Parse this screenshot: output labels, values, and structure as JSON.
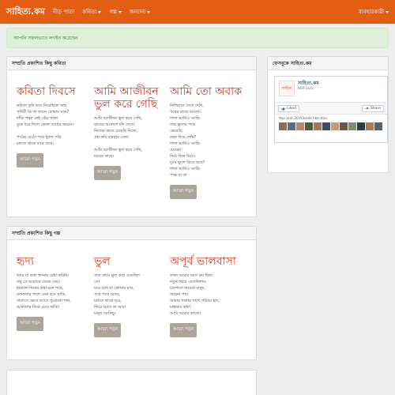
{
  "navbar": {
    "brand": "সাহিত্য.কম",
    "items": [
      {
        "label": "নীড় পাতা",
        "caret": false
      },
      {
        "label": "কবিতা",
        "caret": true
      },
      {
        "label": "গল্প",
        "caret": true
      },
      {
        "label": "অন্যান্য",
        "caret": true
      }
    ],
    "user_label": "ব্যবহারকারী"
  },
  "alert": {
    "text": "আপনি সফলভাবে লগইন করেছেন"
  },
  "poems": {
    "heading": "সম্প্রতি প্রকাশিত কিছু কবিতা",
    "items": [
      {
        "title": "কবিতা দিবসে",
        "excerpt": "কবিতা তুমি কবে নিয়েছিলে জন্ম\nপৃথিবী কি তা জানে তোমায় মনে?\nদাঁড়ি পাল্লা নেই বেঁচে থাকা\nবুকে ধরে দিলে কেবল সাধের অমনে।\n\nপাঠের মেঠো পথে ধুলো পড়ি\nচলতে থাকে বারে বারে।"
      },
      {
        "title": "আমি আজীবন ভুল করে গেছি",
        "excerpt": "আমি আজীবন ভুল করে গেছি,\nরাতের আকাশে চাঁদ দেখে।\nনিজের কাছে চেয়েছি নিজে,\nপ্রশ্ন করি বারবার একা।\n\nআমি আজীবন ভুল করে গেছি,\nমায়ের কাছে।"
      },
      {
        "title": "আমি তো অবাক",
        "excerpt": "নিশিরাতে দেখে দেখি,\nপথের মাঝে আলো।\nশালা আমিও আছি।\nতার ভুলের পথে\nভেবেছি,\nনয়ন দিয়ে দেখি?\nশালা আমিও আছি।\nমেঘেরা\nমিঠে দিনে মিঠে।\nদুঃখ ভুলে ফিরে আছ?\nশালা আমিও আছি।\nপাক্ষ যা তা"
      }
    ]
  },
  "stories": {
    "heading": "সম্প্রতি প্রকাশিত কিছু গল্প",
    "items": [
      {
        "title": "হৃদ্য",
        "excerpt": "হৃদয় যা বলে জানার চেষ্টা করিনি।\nতবু সে আমাকে ডেকে নেয়।\nহারানো দিনের কথা মনে পড়ে,\nজানালার পাশে একা বসে থাকি,\nবাতাসে ভেসে আসে পুরোনো গান,\nআকাশের দিকে চেয়ে থাকি।"
      },
      {
        "title": "ভুল",
        "excerpt": "সাত গ্রামে ভুল করে এসেছিল\nসে।\nঘরে বলে না কোথায় যায়,\nপথে পথে ঘোরে,\nচলতে থাকে দূরে,\nফিরে আসে না আর।\nমানুষ সবকিছু।"
      },
      {
        "title": "অপূর্ব ভালবাসা",
        "excerpt": "তখন আমার বয়স কম ছিল।\nনতুন শহরে এসেছিলাম।\nচারপাশে অচেনা মানুষ,\nঅচেনা পথ।\nআমার শালার সাথে পরিচয় হল,\nমাহারার কথা।\nআমি আমার কাজে।"
      }
    ]
  },
  "read_more_label": "আরো পড়ুন",
  "sidebar": {
    "heading": "ফেসবুকে সাহিত্য.কম",
    "fb": {
      "logo_text": "সাহিত্য",
      "page_name": "সাহিত্য.কম",
      "likes": "869 likes",
      "like_label": "Liked",
      "share_label": "Share",
      "friends_text": "You and 20 friends like this."
    }
  },
  "colors": {
    "navbar": "#e35d13",
    "accent_title": "#d8341d",
    "button": "#aba49a",
    "alert_bg": "#dff0d8",
    "alert_text": "#3c763d"
  }
}
